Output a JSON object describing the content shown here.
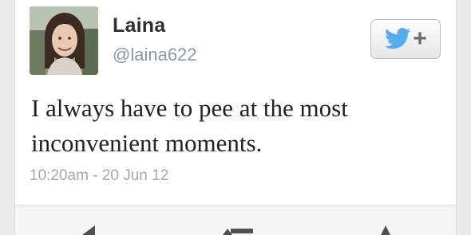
{
  "tweet": {
    "user": {
      "display_name": "Laina",
      "handle": "@laina622"
    },
    "follow_button": {
      "icon": "twitter-bird-icon",
      "plus": "+"
    },
    "text": "I always have to pee at the most inconvenient moments.",
    "timestamp": "10:20am - 20 Jun 12"
  },
  "actions": [
    {
      "icon": "reply-icon"
    },
    {
      "icon": "retweet-icon"
    },
    {
      "icon": "favorite-icon"
    }
  ],
  "colors": {
    "brand": "#55acee",
    "name": "#292f33",
    "meta": "#8899a6"
  }
}
